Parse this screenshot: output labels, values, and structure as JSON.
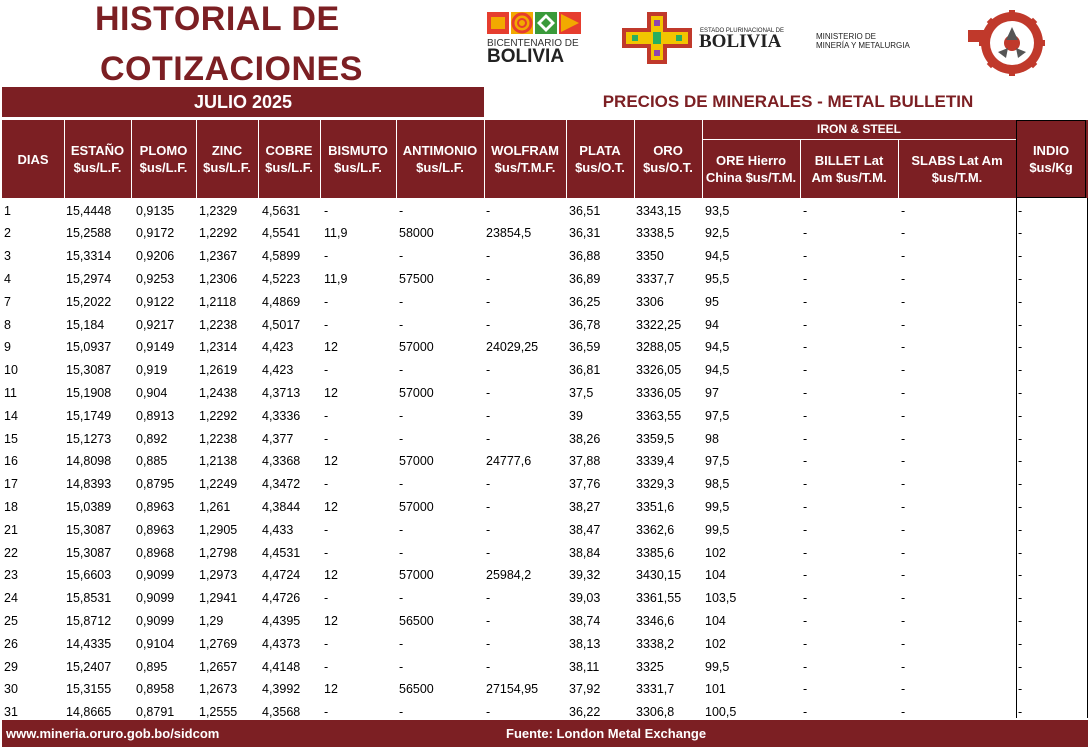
{
  "header": {
    "title_line1": "HISTORIAL DE",
    "title_line2": "COTIZACIONES",
    "bicentenario_line1": "BICENTENARIO DE",
    "bicentenario_line2": "BOLIVIA",
    "estado_small": "ESTADO PLURINACIONAL DE",
    "estado_big": "BOLIVIA",
    "ministerio_line1": "MINISTERIO DE",
    "ministerio_line2": "MINERÍA Y METALURGIA"
  },
  "month_label": "JULIO 2025",
  "prices_title": "PRECIOS DE MINERALES - METAL BULLETIN",
  "columns": {
    "dias": "DIAS",
    "estano": [
      "ESTAÑO",
      "$us/L.F."
    ],
    "plomo": [
      "PLOMO",
      "$us/L.F."
    ],
    "zinc": [
      "ZINC",
      "$us/L.F."
    ],
    "cobre": [
      "COBRE",
      "$us/L.F."
    ],
    "bismuto": [
      "BISMUTO",
      "$us/L.F."
    ],
    "antimonio": [
      "ANTIMONIO",
      "$us/L.F."
    ],
    "wolfram": [
      "WOLFRAM",
      "$us/T.M.F."
    ],
    "plata": [
      "PLATA",
      "$us/O.T."
    ],
    "oro": [
      "ORO",
      "$us/O.T."
    ],
    "iron_steel": "IRON & STEEL",
    "ore_hierro": [
      "ORE Hierro",
      "China $us/T.M."
    ],
    "billet": [
      "BILLET Lat",
      "Am $us/T.M."
    ],
    "slabs": [
      "SLABS Lat Am",
      "$us/T.M."
    ],
    "indio": [
      "INDIO",
      "$us/Kg"
    ]
  },
  "rows": [
    [
      "1",
      "15,4448",
      "0,9135",
      "1,2329",
      "4,5631",
      "-",
      "-",
      "-",
      "36,51",
      "3343,15",
      "93,5",
      "-",
      "-",
      "-"
    ],
    [
      "2",
      "15,2588",
      "0,9172",
      "1,2292",
      "4,5541",
      "11,9",
      "58000",
      "23854,5",
      "36,31",
      "3338,5",
      "92,5",
      "-",
      "-",
      "-"
    ],
    [
      "3",
      "15,3314",
      "0,9206",
      "1,2367",
      "4,5899",
      "-",
      "-",
      "-",
      "36,88",
      "3350",
      "94,5",
      "-",
      "-",
      "-"
    ],
    [
      "4",
      "15,2974",
      "0,9253",
      "1,2306",
      "4,5223",
      "11,9",
      "57500",
      "-",
      "36,89",
      "3337,7",
      "95,5",
      "-",
      "-",
      "-"
    ],
    [
      "7",
      "15,2022",
      "0,9122",
      "1,2118",
      "4,4869",
      "-",
      "-",
      "-",
      "36,25",
      "3306",
      "95",
      "-",
      "-",
      "-"
    ],
    [
      "8",
      "15,184",
      "0,9217",
      "1,2238",
      "4,5017",
      "-",
      "-",
      "-",
      "36,78",
      "3322,25",
      "94",
      "-",
      "-",
      "-"
    ],
    [
      "9",
      "15,0937",
      "0,9149",
      "1,2314",
      "4,423",
      "12",
      "57000",
      "24029,25",
      "36,59",
      "3288,05",
      "94,5",
      "-",
      "-",
      "-"
    ],
    [
      "10",
      "15,3087",
      "0,919",
      "1,2619",
      "4,423",
      "-",
      "-",
      "-",
      "36,81",
      "3326,05",
      "94,5",
      "-",
      "-",
      "-"
    ],
    [
      "11",
      "15,1908",
      "0,904",
      "1,2438",
      "4,3713",
      "12",
      "57000",
      "-",
      "37,5",
      "3336,05",
      "97",
      "-",
      "-",
      "-"
    ],
    [
      "14",
      "15,1749",
      "0,8913",
      "1,2292",
      "4,3336",
      "-",
      "-",
      "-",
      "39",
      "3363,55",
      "97,5",
      "-",
      "-",
      "-"
    ],
    [
      "15",
      "15,1273",
      "0,892",
      "1,2238",
      "4,377",
      "-",
      "-",
      "-",
      "38,26",
      "3359,5",
      "98",
      "-",
      "-",
      "-"
    ],
    [
      "16",
      "14,8098",
      "0,885",
      "1,2138",
      "4,3368",
      "12",
      "57000",
      "24777,6",
      "37,88",
      "3339,4",
      "97,5",
      "-",
      "-",
      "-"
    ],
    [
      "17",
      "14,8393",
      "0,8795",
      "1,2249",
      "4,3472",
      "-",
      "-",
      "-",
      "37,76",
      "3329,3",
      "98,5",
      "-",
      "-",
      "-"
    ],
    [
      "18",
      "15,0389",
      "0,8963",
      "1,261",
      "4,3844",
      "12",
      "57000",
      "-",
      "38,27",
      "3351,6",
      "99,5",
      "-",
      "-",
      "-"
    ],
    [
      "21",
      "15,3087",
      "0,8963",
      "1,2905",
      "4,433",
      "-",
      "-",
      "-",
      "38,47",
      "3362,6",
      "99,5",
      "-",
      "-",
      "-"
    ],
    [
      "22",
      "15,3087",
      "0,8968",
      "1,2798",
      "4,4531",
      "-",
      "-",
      "-",
      "38,84",
      "3385,6",
      "102",
      "-",
      "-",
      "-"
    ],
    [
      "23",
      "15,6603",
      "0,9099",
      "1,2973",
      "4,4724",
      "12",
      "57000",
      "25984,2",
      "39,32",
      "3430,15",
      "104",
      "-",
      "-",
      "-"
    ],
    [
      "24",
      "15,8531",
      "0,9099",
      "1,2941",
      "4,4726",
      "-",
      "-",
      "-",
      "39,03",
      "3361,55",
      "103,5",
      "-",
      "-",
      "-"
    ],
    [
      "25",
      "15,8712",
      "0,9099",
      "1,29",
      "4,4395",
      "12",
      "56500",
      "-",
      "38,74",
      "3346,6",
      "104",
      "-",
      "-",
      "-"
    ],
    [
      "26",
      "14,4335",
      "0,9104",
      "1,2769",
      "4,4373",
      "-",
      "-",
      "-",
      "38,13",
      "3338,2",
      "102",
      "-",
      "-",
      "-"
    ],
    [
      "29",
      "15,2407",
      "0,895",
      "1,2657",
      "4,4148",
      "-",
      "-",
      "-",
      "38,11",
      "3325",
      "99,5",
      "-",
      "-",
      "-"
    ],
    [
      "30",
      "15,3155",
      "0,8958",
      "1,2673",
      "4,3992",
      "12",
      "56500",
      "27154,95",
      "37,92",
      "3331,7",
      "101",
      "-",
      "-",
      "-"
    ],
    [
      "31",
      "14,8665",
      "0,8791",
      "1,2555",
      "4,3568",
      "-",
      "-",
      "-",
      "36,22",
      "3306,8",
      "100,5",
      "-",
      "-",
      "-"
    ]
  ],
  "footer": {
    "website": "www.mineria.oruro.gob.bo/sidcom",
    "source": "Fuente: London Metal Exchange"
  },
  "colors": {
    "brand": "#7c1f23"
  }
}
